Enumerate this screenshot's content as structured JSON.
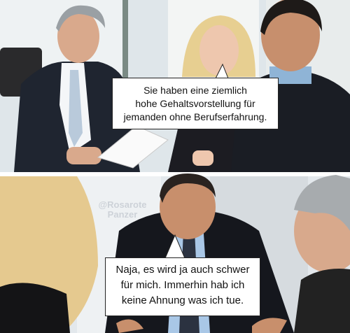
{
  "panel_top": {
    "speech": {
      "lines": [
        "Sie haben eine ziemlich",
        "hohe Gehaltsvorstellung für",
        "jemanden ohne Berufserfahrung."
      ]
    }
  },
  "panel_bottom": {
    "speech": {
      "lines": [
        "Naja, es wird ja auch schwer",
        "für mich. Immerhin hab ich",
        "keine Ahnung was ich tue."
      ]
    }
  },
  "watermark": {
    "text_lines": [
      "@Rosarote",
      "Panzer"
    ]
  }
}
